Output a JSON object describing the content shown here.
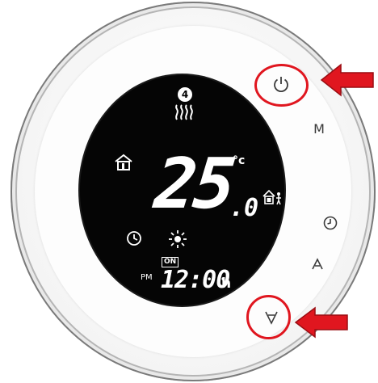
{
  "lcd": {
    "mode_number": "4",
    "temperature_main": "25",
    "temperature_decimal": ".0",
    "temperature_unit": "°c",
    "period": "PM",
    "on_label": "ON",
    "time": "12:00",
    "time_suffix": "h",
    "icons": [
      "heating-waves-icon",
      "home-icon",
      "program-schedule-icon",
      "clock-icon",
      "sun-icon"
    ]
  },
  "buttons": {
    "power_icon": "power-icon",
    "menu_label": "M",
    "clock_icon": "clock-icon",
    "up_icon": "up-chevron-icon",
    "down_icon": "down-chevron-icon"
  },
  "annotations": {
    "highlight_color": "#e0161f",
    "targets": [
      "power-button",
      "down-button"
    ]
  }
}
